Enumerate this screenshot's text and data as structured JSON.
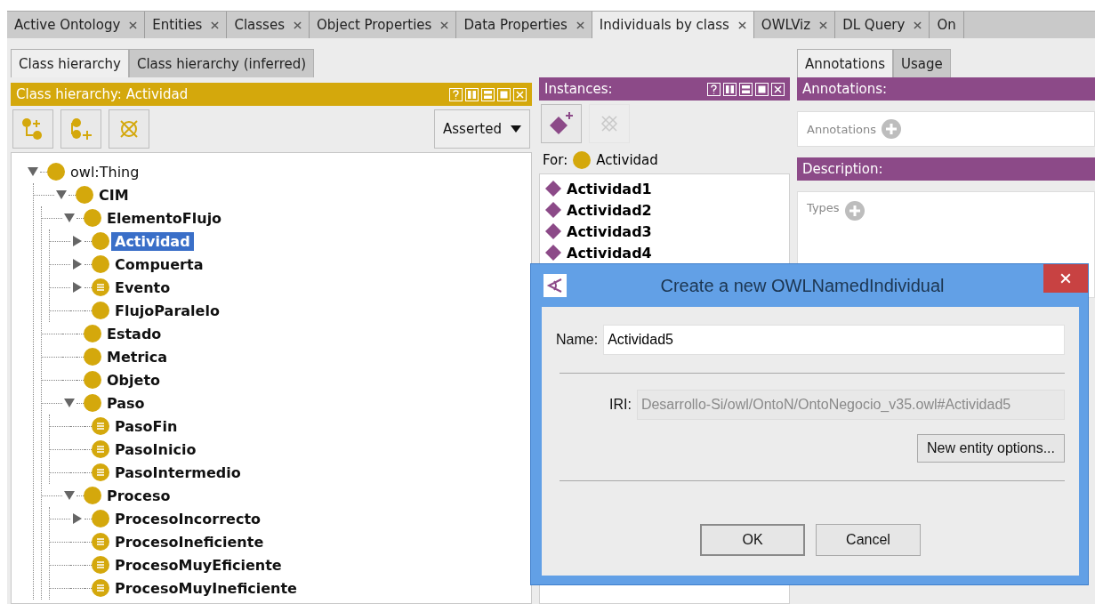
{
  "main_tabs": [
    {
      "label": "Active Ontology",
      "selected": false,
      "closable": true
    },
    {
      "label": "Entities",
      "selected": false,
      "closable": true
    },
    {
      "label": "Classes",
      "selected": false,
      "closable": true
    },
    {
      "label": "Object Properties",
      "selected": false,
      "closable": true
    },
    {
      "label": "Data Properties",
      "selected": false,
      "closable": true
    },
    {
      "label": "Individuals by class",
      "selected": true,
      "closable": true
    },
    {
      "label": "OWLViz",
      "selected": false,
      "closable": true
    },
    {
      "label": "DL Query",
      "selected": false,
      "closable": true
    },
    {
      "label": "On",
      "selected": false,
      "closable": false
    }
  ],
  "class_panel": {
    "tabs": [
      {
        "label": "Class hierarchy",
        "selected": true
      },
      {
        "label": "Class hierarchy (inferred)",
        "selected": false
      }
    ],
    "header": "Class hierarchy: Actividad",
    "mode": "Asserted",
    "tree": [
      {
        "label": "owl:Thing",
        "kind": "primitive",
        "expanded": true,
        "selected": false,
        "children": [
          {
            "label": "CIM",
            "kind": "primitive",
            "expanded": true,
            "selected": false,
            "children": [
              {
                "label": "ElementoFlujo",
                "kind": "primitive",
                "expanded": true,
                "selected": false,
                "children": [
                  {
                    "label": "Actividad",
                    "kind": "primitive",
                    "expanded": false,
                    "selected": true
                  },
                  {
                    "label": "Compuerta",
                    "kind": "primitive",
                    "expanded": false,
                    "selected": false
                  },
                  {
                    "label": "Evento",
                    "kind": "defined",
                    "expanded": false,
                    "selected": false
                  },
                  {
                    "label": "FlujoParalelo",
                    "kind": "primitive",
                    "selected": false
                  }
                ]
              },
              {
                "label": "Estado",
                "kind": "primitive",
                "selected": false
              },
              {
                "label": "Metrica",
                "kind": "primitive",
                "selected": false
              },
              {
                "label": "Objeto",
                "kind": "primitive",
                "selected": false
              },
              {
                "label": "Paso",
                "kind": "primitive",
                "expanded": true,
                "selected": false,
                "children": [
                  {
                    "label": "PasoFin",
                    "kind": "defined",
                    "selected": false
                  },
                  {
                    "label": "PasoInicio",
                    "kind": "defined",
                    "selected": false
                  },
                  {
                    "label": "PasoIntermedio",
                    "kind": "defined",
                    "selected": false
                  }
                ]
              },
              {
                "label": "Proceso",
                "kind": "primitive",
                "expanded": true,
                "selected": false,
                "children": [
                  {
                    "label": "ProcesoIncorrecto",
                    "kind": "primitive",
                    "expanded": false,
                    "selected": false
                  },
                  {
                    "label": "ProcesoIneficiente",
                    "kind": "defined",
                    "selected": false
                  },
                  {
                    "label": "ProcesoMuyEficiente",
                    "kind": "defined",
                    "selected": false
                  },
                  {
                    "label": "ProcesoMuyIneficiente",
                    "kind": "defined",
                    "selected": false
                  }
                ]
              }
            ]
          }
        ]
      }
    ]
  },
  "instances_panel": {
    "header": "Instances:",
    "tools": [
      {
        "kind": "add",
        "disabled": false
      },
      {
        "kind": "delete",
        "disabled": true
      }
    ],
    "for_label": "For:",
    "for_class": "Actividad",
    "instances": [
      "Actividad1",
      "Actividad2",
      "Actividad3",
      "Actividad4"
    ]
  },
  "annotation_panel": {
    "tabs": [
      {
        "label": "Annotations",
        "selected": true
      },
      {
        "label": "Usage",
        "selected": false
      }
    ],
    "annotations_header": "Annotations:",
    "annotations_label": "Annotations",
    "description_header": "Description:",
    "types_label": "Types"
  },
  "dialog": {
    "title": "Create a new OWLNamedIndividual",
    "name_label": "Name:",
    "name_value": "Actividad5",
    "iri_label": "IRI:",
    "iri_value": "Desarrollo-Si/owl/OntoN/OntoNegocio_v35.owl#Actividad5",
    "options_button": "New entity options...",
    "buttons": [
      {
        "label": "OK",
        "default": true
      },
      {
        "label": "Cancel",
        "default": false
      }
    ]
  }
}
